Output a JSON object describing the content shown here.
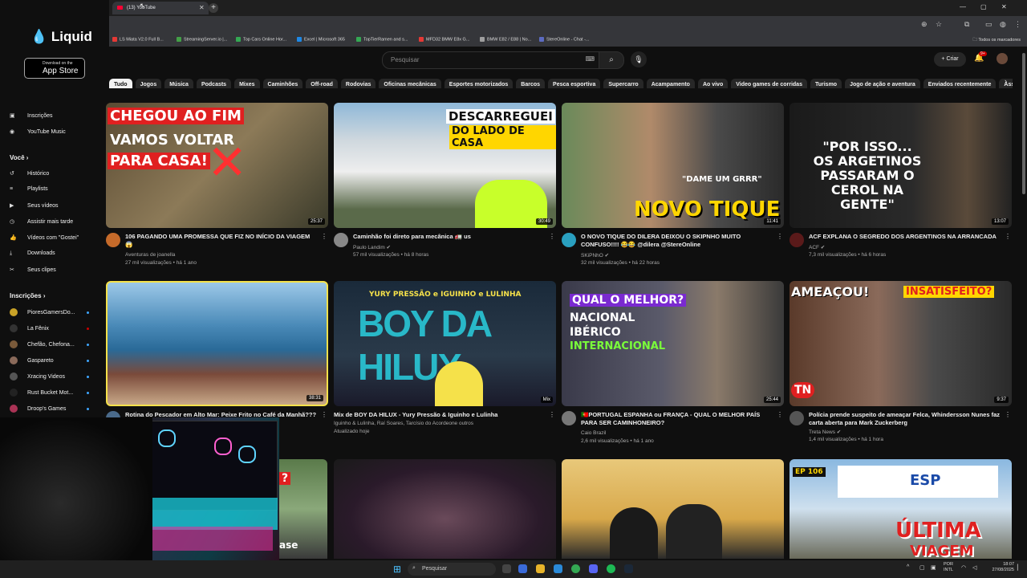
{
  "promo": {
    "logo": "Liquid",
    "store_small": "Download on the",
    "store_big": "App Store"
  },
  "browser": {
    "tab_title": "(13) YouTube",
    "bookmarks": [
      {
        "label": "LS Miata V2.0 Full B...",
        "color": "#e53935"
      },
      {
        "label": "StreamingServer.io |...",
        "color": "#43a047"
      },
      {
        "label": "Top Cars Online Hor...",
        "color": "#34a853"
      },
      {
        "label": "Excel | Microsoft 365",
        "color": "#1e88e5"
      },
      {
        "label": "TopTierRamen and s...",
        "color": "#34a853"
      },
      {
        "label": "MFD32 BMW E8x G...",
        "color": "#e53935"
      },
      {
        "label": "BMW E82 / E88 | No...",
        "color": "#9e9e9e"
      },
      {
        "label": "StereOnline - Chat -...",
        "color": "#5c6bc0"
      }
    ],
    "bookmarks_folder": "Todos os marcadores"
  },
  "header": {
    "search_placeholder": "Pesquisar",
    "create_label": "Criar",
    "notif_count": "9+"
  },
  "chips": [
    "Tudo",
    "Jogos",
    "Música",
    "Podcasts",
    "Mixes",
    "Caminhões",
    "Off-road",
    "Rodovias",
    "Oficinas mecânicas",
    "Esportes motorizados",
    "Barcos",
    "Pesca esportiva",
    "Supercarro",
    "Acampamento",
    "Ao vivo",
    "Video games de corridas",
    "Turismo",
    "Jogo de ação e aventura",
    "Enviados recentemente",
    "Assi"
  ],
  "sidebar": {
    "top": [
      {
        "label": "Inscrições",
        "icon": "▣"
      },
      {
        "label": "YouTube Music",
        "icon": "◉"
      }
    ],
    "voce_title": "Você",
    "voce": [
      {
        "label": "Histórico",
        "icon": "↺"
      },
      {
        "label": "Playlists",
        "icon": "≡"
      },
      {
        "label": "Seus vídeos",
        "icon": "▶"
      },
      {
        "label": "Assistir mais tarde",
        "icon": "◷"
      },
      {
        "label": "Vídeos com \"Gostei\"",
        "icon": "👍"
      },
      {
        "label": "Downloads",
        "icon": "⤓"
      },
      {
        "label": "Seus clipes",
        "icon": "✂"
      }
    ],
    "subs_title": "Inscrições",
    "subs": [
      {
        "label": "PioresGamersDo...",
        "color": "#c9a227"
      },
      {
        "label": "La Fênix",
        "color": "#333"
      },
      {
        "label": "Chefão, Chefona...",
        "color": "#7a5a3a"
      },
      {
        "label": "Gaspareto",
        "color": "#8a6a5a"
      },
      {
        "label": "Xracing Videos",
        "color": "#555"
      },
      {
        "label": "Rust Bucket Mot...",
        "color": "#222"
      },
      {
        "label": "Droop's Games",
        "color": "#aa3355"
      }
    ]
  },
  "videos": [
    {
      "title": "106 PAGANDO UMA PROMESSA QUE FIZ NO INÍCIO DA VIAGEM 😱",
      "channel": "Aventuras de joanella",
      "meta": "27 mil visualizações • há 1 ano",
      "duration": "25:37",
      "thumb_text": [
        "CHEGOU AO FIM",
        "VAMOS VOLTAR",
        "PARA CASA!"
      ]
    },
    {
      "title": "Caminhão foi direto para mecânica 🚛 us",
      "channel": "Paulo Landim ✔",
      "meta": "57 mil visualizações • há 8 horas",
      "duration": "30:49",
      "thumb_text": [
        "DESCARREGUEI",
        "DO LADO DE CASA"
      ]
    },
    {
      "title": "O NOVO TIQUE DO DILERA DEIXOU O SKIPNHO MUITO CONFUSO!!!! 😂😂 @dilera @StereOnline",
      "channel": "SKiPNhO ✔",
      "meta": "32 mil visualizações • há 22 horas",
      "duration": "11:41",
      "thumb_text": [
        "\"DAME UM GRRR\"",
        "NOVO TIQUE"
      ]
    },
    {
      "title": "ACF EXPLANA O SEGREDO DOS ARGENTINOS NA ARRANCADA",
      "channel": "ACF ✔",
      "meta": "7,3 mil visualizações • há 6 horas",
      "duration": "13:07",
      "thumb_text": [
        "\"POR ISSO...",
        "OS ARGETINOS",
        "PASSARAM O",
        "CEROL NA",
        "GENTE\""
      ]
    },
    {
      "title": "Rotina do Pescador em Alto Mar: Peixe Frito no Café da Manhã???",
      "channel": "",
      "meta": "",
      "duration": "38:31",
      "thumb_text": []
    },
    {
      "title": "Mix de BOY DA HILUX - Yury Pressão & Iguinho e Lulinha",
      "channel": "Iguinho & Lulinha, Raí Soares, Tarcísio do Acordeone outros",
      "meta": "Atualizado hoje",
      "duration": "Mix",
      "thumb_text": [
        "YURY PRESSÃO e IGUINHO e LULINHA",
        "BOY DA HILUX"
      ]
    },
    {
      "title": "🇵🇹PORTUGAL ESPANHA ou FRANÇA - QUAL O MELHOR PAÍS PARA SER CAMINHONEIRO?",
      "channel": "Caio Brazil",
      "meta": "2,6 mil visualizações • há 1 ano",
      "duration": "25:44",
      "thumb_text": [
        "QUAL O MELHOR?",
        "NACIONAL",
        "IBÉRICO",
        "INTERNACIONAL"
      ]
    },
    {
      "title": "Polícia prende suspeito de ameaçar Felca, Whindersson Nunes faz carta aberta para Mark Zuckerberg",
      "channel": "Treta News ✔",
      "meta": "1,4 mil visualizações • há 1 hora",
      "duration": "9:37",
      "thumb_text": [
        "AMEAÇOU!",
        "INSATISFEITO?",
        "TN"
      ]
    },
    {
      "title": "",
      "channel": "",
      "meta": "",
      "duration": "",
      "thumb_text": [
        "?",
        "ase"
      ]
    },
    {
      "title": "",
      "channel": "",
      "meta": "",
      "duration": "",
      "thumb_text": []
    },
    {
      "title": "",
      "channel": "",
      "meta": "",
      "duration": "",
      "thumb_text": []
    },
    {
      "title": "",
      "channel": "",
      "meta": "",
      "duration": "",
      "thumb_text": [
        "EP 106",
        "ESP",
        "ÚLTIMA",
        "VIAGEM"
      ]
    }
  ],
  "taskbar": {
    "search": "Pesquisar",
    "lang1": "POR",
    "lang2": "INTL",
    "time": "18:07",
    "date": "27/08/2025"
  }
}
